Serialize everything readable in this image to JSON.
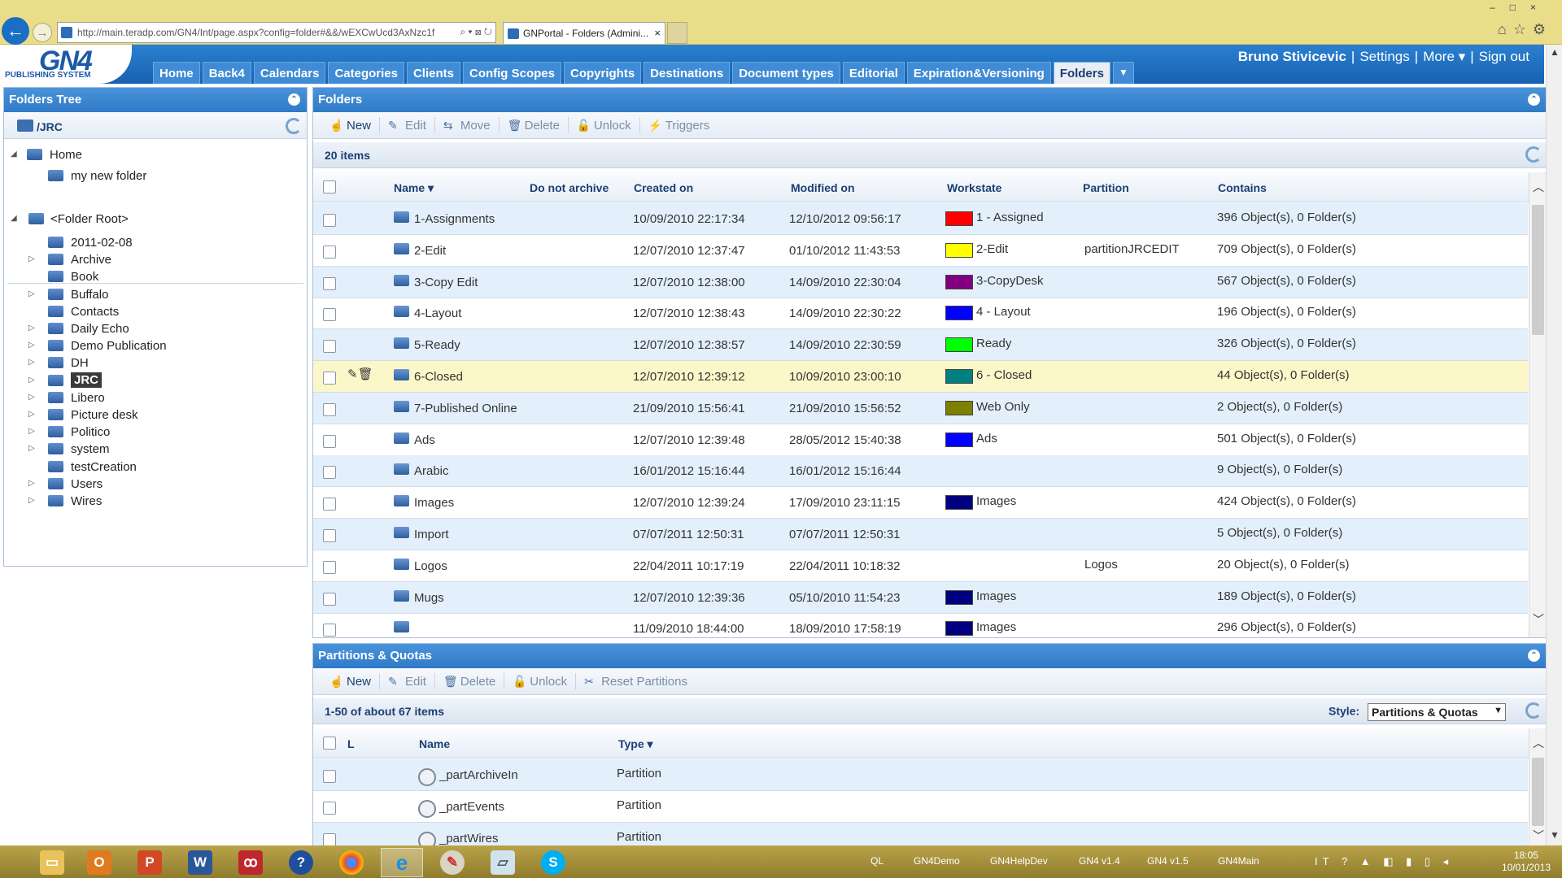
{
  "browser": {
    "url": "http://main.teradp.com/GN4/Int/page.aspx?config=folder#&&/wEXCwUcd3AxNzc1f",
    "tab_title": "GNPortal - Folders (Admini...",
    "tab_close": "×",
    "addr_tools": "⌕ ▾ ⊠ ↻",
    "window_controls": "–□×",
    "icons": "⌂☆⚙"
  },
  "app": {
    "logo_big": "GN4",
    "logo_small": "PUBLISHING SYSTEM",
    "user": "Bruno Stivicevic",
    "settings": "Settings",
    "more": "More ▾",
    "signout": "Sign out",
    "menu": [
      "Home",
      "Back4",
      "Calendars",
      "Categories",
      "Clients",
      "Config Scopes",
      "Copyrights",
      "Destinations",
      "Document types",
      "Editorial",
      "Expiration&Versioning",
      "Folders"
    ],
    "menu_dropdown": "▼"
  },
  "tree": {
    "title": "Folders Tree",
    "path": "/JRC",
    "home": "Home",
    "home_child": "my new folder",
    "root": "<Folder Root>",
    "items": [
      {
        "label": "2011-02-08",
        "exp": ""
      },
      {
        "label": "Archive",
        "exp": "▷"
      },
      {
        "label": "Book",
        "exp": ""
      },
      {
        "label": "Buffalo",
        "exp": "▷"
      },
      {
        "label": "Contacts",
        "exp": ""
      },
      {
        "label": "Daily Echo",
        "exp": "▷"
      },
      {
        "label": "Demo Publication",
        "exp": "▷"
      },
      {
        "label": "DH",
        "exp": "▷"
      },
      {
        "label": "JRC",
        "exp": "▷"
      },
      {
        "label": "Libero",
        "exp": "▷"
      },
      {
        "label": "Picture desk",
        "exp": "▷"
      },
      {
        "label": "Politico",
        "exp": "▷"
      },
      {
        "label": "system",
        "exp": "▷"
      },
      {
        "label": "testCreation",
        "exp": ""
      },
      {
        "label": "Users",
        "exp": "▷"
      },
      {
        "label": "Wires",
        "exp": "▷"
      }
    ]
  },
  "folders": {
    "title": "Folders",
    "toolbar": [
      "New",
      "Edit",
      "Move",
      "Delete",
      "Unlock",
      "Triggers"
    ],
    "toolbar_icons": [
      "☝",
      "✎",
      "⇆",
      "🗑",
      "🔓",
      "⚡"
    ],
    "count": "20 items",
    "columns": [
      "Name ▾",
      "Do not archive",
      "Created on",
      "Modified on",
      "Workstate",
      "Partition",
      "Contains"
    ],
    "rows": [
      {
        "name": "1-Assignments",
        "created": "10/09/2010 22:17:34",
        "modified": "12/10/2012 09:56:17",
        "color": "#ff0000",
        "workstate": "1 - Assigned",
        "partition": "",
        "contains": "396 Object(s), 0 Folder(s)"
      },
      {
        "name": "2-Edit",
        "created": "12/07/2010 12:37:47",
        "modified": "01/10/2012 11:43:53",
        "color": "#ffff00",
        "workstate": "2-Edit",
        "partition": "partitionJRCEDIT",
        "contains": "709 Object(s), 0 Folder(s)"
      },
      {
        "name": "3-Copy Edit",
        "created": "12/07/2010 12:38:00",
        "modified": "14/09/2010 22:30:04",
        "color": "#800080",
        "workstate": "3-CopyDesk",
        "partition": "",
        "contains": "567 Object(s), 0 Folder(s)"
      },
      {
        "name": "4-Layout",
        "created": "12/07/2010 12:38:43",
        "modified": "14/09/2010 22:30:22",
        "color": "#0000ff",
        "workstate": "4 - Layout",
        "partition": "",
        "contains": "196 Object(s), 0 Folder(s)"
      },
      {
        "name": "5-Ready",
        "created": "12/07/2010 12:38:57",
        "modified": "14/09/2010 22:30:59",
        "color": "#00ff00",
        "workstate": "Ready",
        "partition": "",
        "contains": "326 Object(s), 0 Folder(s)"
      },
      {
        "name": "6-Closed",
        "created": "12/07/2010 12:39:12",
        "modified": "10/09/2010 23:00:10",
        "color": "#008080",
        "workstate": "6 - Closed",
        "partition": "",
        "contains": "44 Object(s), 0 Folder(s)"
      },
      {
        "name": "7-Published Online",
        "created": "21/09/2010 15:56:41",
        "modified": "21/09/2010 15:56:52",
        "color": "#808000",
        "workstate": "Web Only",
        "partition": "",
        "contains": "2 Object(s), 0 Folder(s)"
      },
      {
        "name": "Ads",
        "created": "12/07/2010 12:39:48",
        "modified": "28/05/2012 15:40:38",
        "color": "#0000ff",
        "workstate": "Ads",
        "partition": "",
        "contains": "501 Object(s), 0 Folder(s)"
      },
      {
        "name": "Arabic",
        "created": "16/01/2012 15:16:44",
        "modified": "16/01/2012 15:16:44",
        "color": "",
        "workstate": "",
        "partition": "",
        "contains": "9 Object(s), 0 Folder(s)"
      },
      {
        "name": "Images",
        "created": "12/07/2010 12:39:24",
        "modified": "17/09/2010 23:11:15",
        "color": "#000080",
        "workstate": "Images",
        "partition": "",
        "contains": "424 Object(s), 0 Folder(s)"
      },
      {
        "name": "Import",
        "created": "07/07/2011 12:50:31",
        "modified": "07/07/2011 12:50:31",
        "color": "",
        "workstate": "",
        "partition": "",
        "contains": "5 Object(s), 0 Folder(s)"
      },
      {
        "name": "Logos",
        "created": "22/04/2011 10:17:19",
        "modified": "22/04/2011 10:18:32",
        "color": "",
        "workstate": "",
        "partition": "Logos",
        "contains": "20 Object(s), 0 Folder(s)"
      },
      {
        "name": "Mugs",
        "created": "12/07/2010 12:39:36",
        "modified": "05/10/2010 11:54:23",
        "color": "#000080",
        "workstate": "Images",
        "partition": "",
        "contains": "189 Object(s), 0 Folder(s)"
      },
      {
        "name": "",
        "created": "11/09/2010 18:44:00",
        "modified": "18/09/2010 17:58:19",
        "color": "#000080",
        "workstate": "Images",
        "partition": "",
        "contains": "296 Object(s), 0 Folder(s)"
      }
    ],
    "highlight_row": 5,
    "row_tools": "✎🗑"
  },
  "partitions": {
    "title": "Partitions & Quotas",
    "toolbar": [
      "New",
      "Edit",
      "Delete",
      "Unlock",
      "Reset Partitions"
    ],
    "toolbar_icons": [
      "☝",
      "✎",
      "🗑",
      "🔓",
      "✂"
    ],
    "count": "1-50 of about 67 items",
    "style_label": "Style:",
    "style_value": "Partitions & Quotas",
    "columns": [
      "L",
      "Name",
      "Type ▾"
    ],
    "rows": [
      {
        "name": "_partArchiveIn",
        "type": "Partition"
      },
      {
        "name": "_partEvents",
        "type": "Partition"
      },
      {
        "name": "_partWires",
        "type": "Partition"
      }
    ]
  },
  "taskbar": {
    "links": [
      "QL",
      "GN4Demo",
      "GN4HelpDev",
      "GN4 v1.4",
      "GN4 v1.5",
      "GN4Main"
    ],
    "lang": "IT",
    "time": "18:05",
    "date": "10/01/2013"
  }
}
